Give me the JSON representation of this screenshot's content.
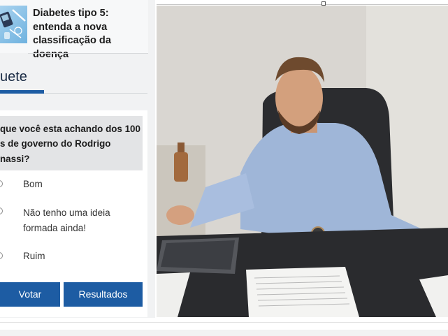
{
  "news": {
    "title_lines": [
      "Diabetes tipo 5:",
      "entenda a nova",
      "classificação da doença"
    ],
    "thumb_icon": "medical-supplies-icon"
  },
  "section": {
    "title": "uete"
  },
  "poll": {
    "question_lines": [
      "que você esta achando dos 100",
      "s de governo do Rodrigo",
      "nassi?"
    ],
    "options": [
      {
        "lines": [
          "Bom"
        ]
      },
      {
        "lines": [
          "Não tenho uma ideia",
          "formada ainda!"
        ]
      },
      {
        "lines": [
          "Ruim"
        ]
      }
    ],
    "vote_label": "Votar",
    "results_label": "Resultados"
  },
  "colors": {
    "accent": "#1d5ca3",
    "sidebar_bg": "#f1f2f3",
    "question_bg": "#e3e4e6"
  }
}
